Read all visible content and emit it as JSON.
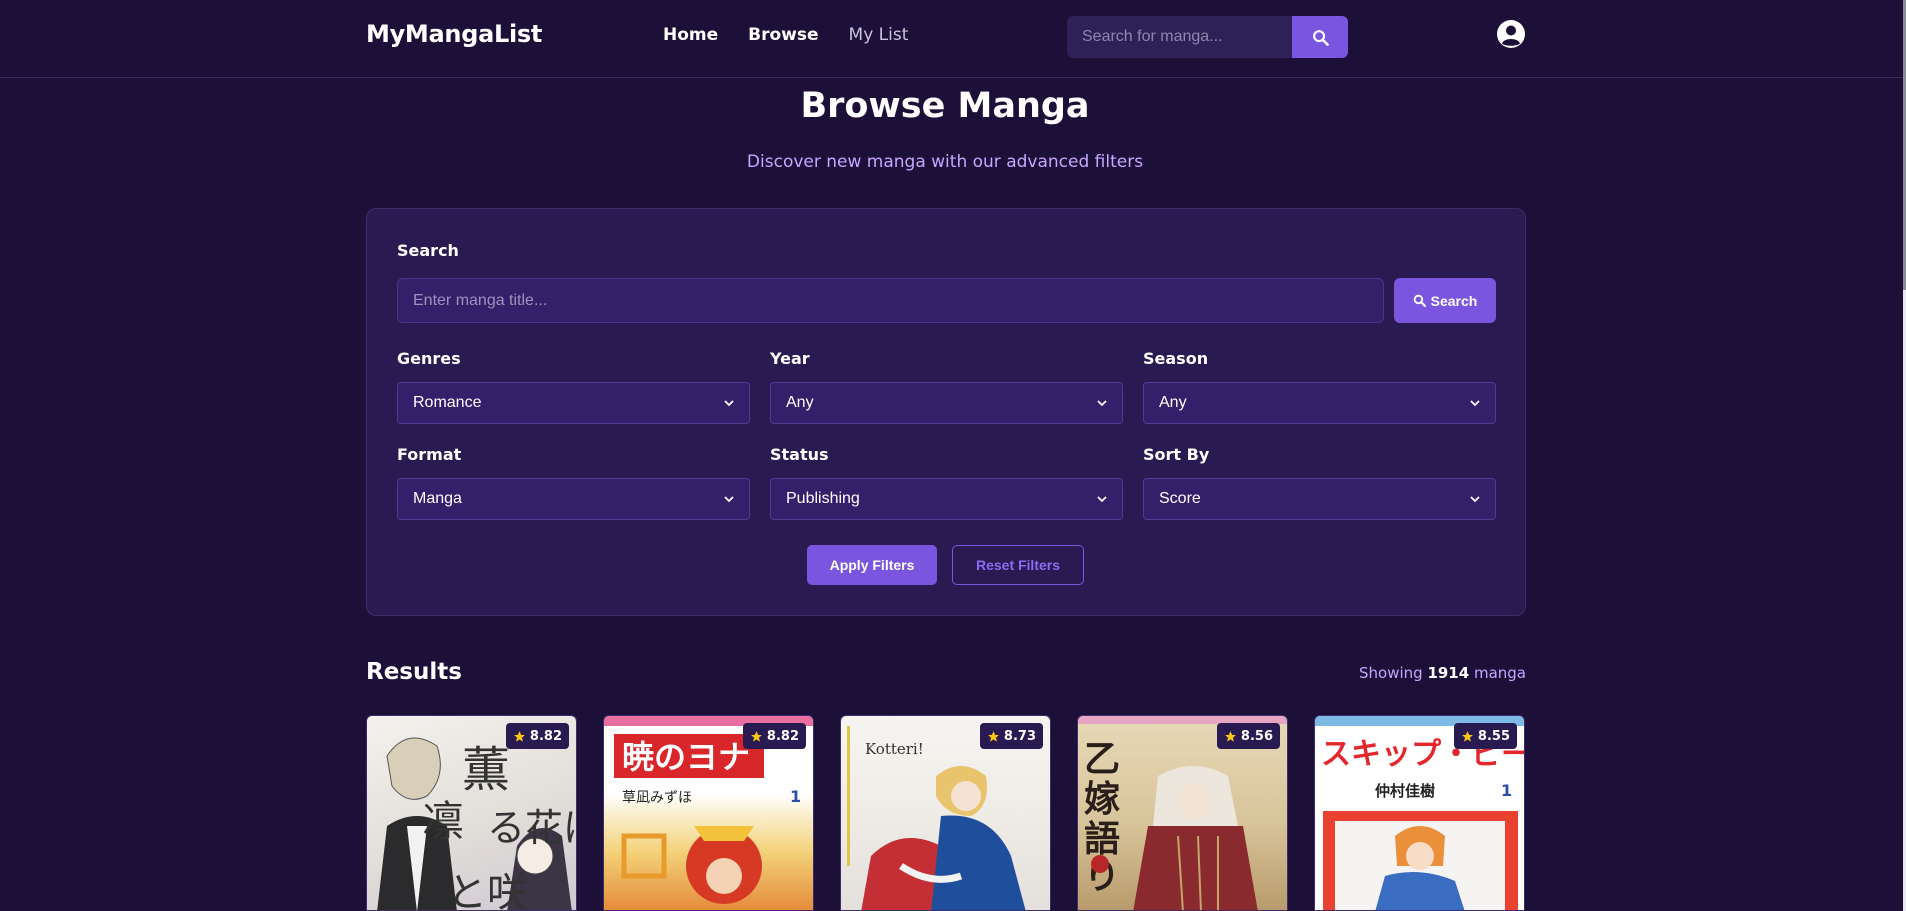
{
  "header": {
    "logo": "MyMangaList",
    "nav": [
      {
        "label": "Home"
      },
      {
        "label": "Browse"
      },
      {
        "label": "My List"
      }
    ],
    "search_placeholder": "Search for manga..."
  },
  "page": {
    "title": "Browse Manga",
    "subtitle": "Discover new manga with our advanced filters"
  },
  "filters": {
    "search_label": "Search",
    "search_placeholder": "Enter manga title...",
    "search_button": "Search",
    "genres": {
      "label": "Genres",
      "value": "Romance"
    },
    "year": {
      "label": "Year",
      "value": "Any"
    },
    "season": {
      "label": "Season",
      "value": "Any"
    },
    "format": {
      "label": "Format",
      "value": "Manga"
    },
    "status": {
      "label": "Status",
      "value": "Publishing"
    },
    "sort": {
      "label": "Sort By",
      "value": "Score"
    },
    "apply_button": "Apply Filters",
    "reset_button": "Reset Filters"
  },
  "results": {
    "title": "Results",
    "count_prefix": "Showing",
    "count": "1914",
    "count_suffix": "manga",
    "items": [
      {
        "score": "8.82"
      },
      {
        "score": "8.82"
      },
      {
        "score": "8.73"
      },
      {
        "score": "8.56"
      },
      {
        "score": "8.55"
      }
    ]
  },
  "colors": {
    "background": "#1c1038",
    "card": "#2a1a52",
    "accent": "#7a55e0",
    "subtitle": "#c6a6ff",
    "star": "#f5c518"
  }
}
